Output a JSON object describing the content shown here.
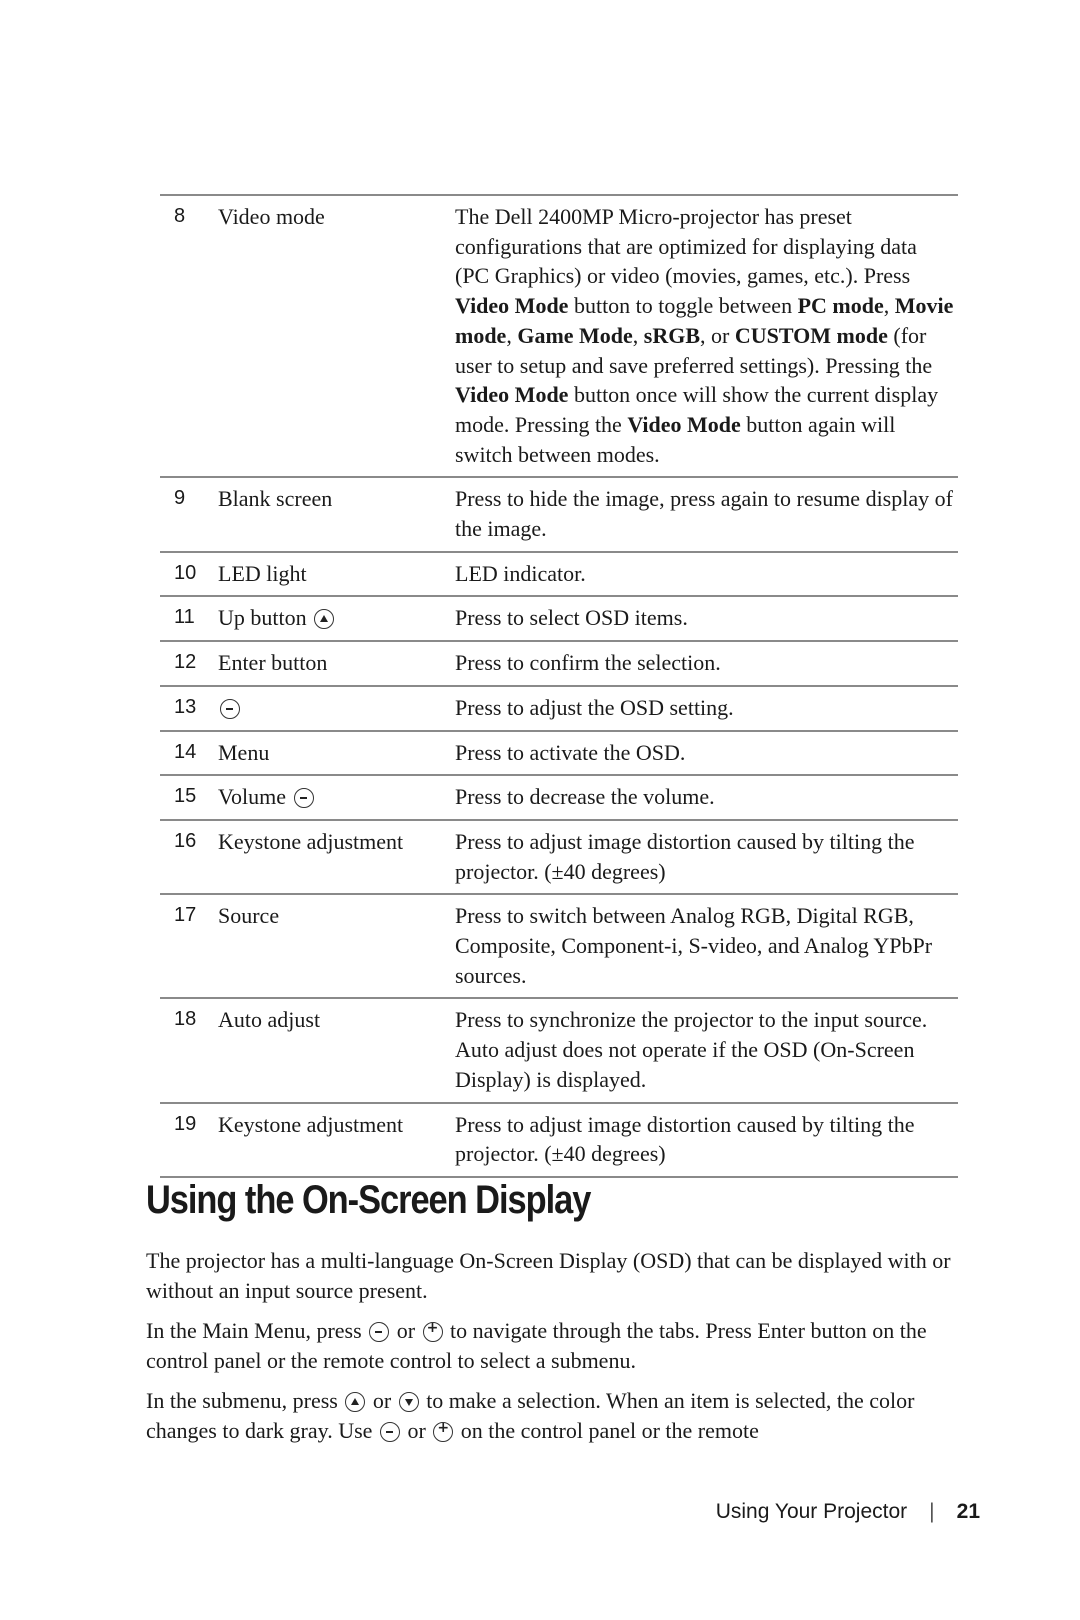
{
  "table": {
    "rows": [
      {
        "num": "8",
        "name": "Video mode",
        "desc_html": "The Dell 2400MP Micro-projector has preset configurations that are optimized for displaying data (PC Graphics) or video (movies, games, etc.). Press <b>Video Mode</b> button to toggle between <b>PC mode</b>, <b>Movie mode</b>, <b>Game Mode</b>, <b>sRGB</b>, or <b>CUSTOM mode</b> (for user to setup and save preferred settings). Pressing the <b>Video Mode</b> button once will show the current display mode. Pressing the <b>Video Mode</b> button again will switch between modes."
      },
      {
        "num": "9",
        "name": "Blank screen",
        "desc_html": "Press to hide the image, press again to resume display of the image."
      },
      {
        "num": "10",
        "name": "LED light",
        "desc_html": "LED indicator."
      },
      {
        "num": "11",
        "name": "Up button",
        "name_icon": "up",
        "desc_html": "Press to select OSD items."
      },
      {
        "num": "12",
        "name": "Enter button",
        "desc_html": "Press to confirm the selection."
      },
      {
        "num": "13",
        "name": "",
        "name_icon": "minus",
        "desc_html": "Press to adjust the OSD setting."
      },
      {
        "num": "14",
        "name": "Menu",
        "desc_html": "Press to activate the OSD."
      },
      {
        "num": "15",
        "name": "Volume",
        "name_icon": "minus",
        "desc_html": "Press to decrease the volume."
      },
      {
        "num": "16",
        "name": "Keystone adjustment",
        "desc_html": "Press to adjust image distortion caused by tilting the projector. (±40 degrees)"
      },
      {
        "num": "17",
        "name": "Source",
        "desc_html": "Press to switch between Analog RGB, Digital RGB, Composite, Component-i, S-video, and Analog YPbPr sources."
      },
      {
        "num": "18",
        "name": "Auto adjust",
        "desc_html": "Press to synchronize the projector to the input source. Auto adjust does not operate if the OSD (On-Screen Display) is displayed."
      },
      {
        "num": "19",
        "name": "Keystone adjustment",
        "desc_html": "Press to adjust image distortion caused by tilting the projector. (±40 degrees)"
      }
    ]
  },
  "section": {
    "heading": "Using the On-Screen Display",
    "paragraphs": [
      "The projector has a multi-language On-Screen Display (OSD) that can be displayed with or without an input source present.",
      "In the Main Menu, press {minus} or {plus}  to navigate through the tabs. Press Enter button on the control panel or the remote control to select a submenu.",
      "In the submenu, press {up} or {down} to make a selection. When an item is selected, the color changes to dark gray. Use {minus} or {plus} on the control panel or the remote"
    ]
  },
  "footer": {
    "section_title": "Using Your Projector",
    "separator": "|",
    "page_number": "21"
  }
}
